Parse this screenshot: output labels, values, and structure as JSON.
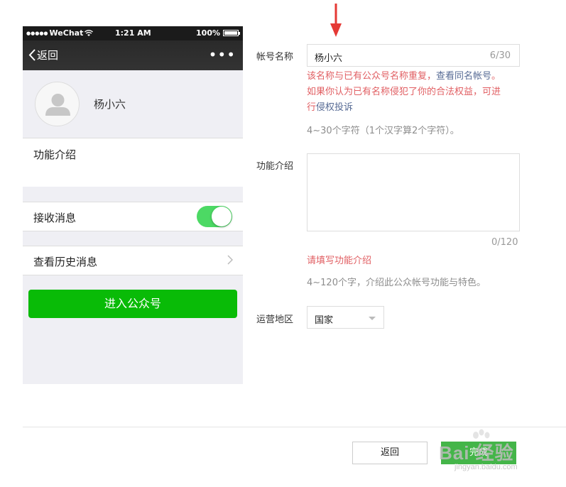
{
  "phone": {
    "status": {
      "carrier": "WeChat",
      "time": "1:21 AM",
      "battery": "100%"
    },
    "nav": {
      "back_label": "返回",
      "more_label": "•••"
    },
    "profile": {
      "name": "杨小六"
    },
    "intro_label": "功能介绍",
    "receive_label": "接收消息",
    "receive_on": true,
    "history_label": "查看历史消息",
    "enter_button": "进入公众号"
  },
  "form": {
    "name_label": "帐号名称",
    "name_value": "杨小六",
    "name_count": "6/30",
    "error_line1_prefix": "该名称与已有公众号名称重复，",
    "error_line1_link": "查看同名帐号",
    "error_line1_suffix": "。",
    "error_line2": "如果你认为已有名称侵犯了你的合法权益，可进",
    "error_line3_prefix": "行",
    "error_line3_link": "侵权投诉",
    "name_hint": "4~30个字符（1个汉字算2个字符）。",
    "intro_label": "功能介绍",
    "intro_count": "0/120",
    "intro_error": "请填写功能介绍",
    "intro_hint": "4~120个字，介绍此公众帐号功能与特色。",
    "region_label": "运营地区",
    "region_value": "国家"
  },
  "footer": {
    "back_button": "返回",
    "done_button": "完成"
  },
  "watermark": {
    "text": "Bai 经验",
    "sub": "jingyan.baidu.com"
  },
  "colors": {
    "green": "#09bb07",
    "error": "#e15f63",
    "link": "#576b95",
    "arrow": "#e53935"
  }
}
